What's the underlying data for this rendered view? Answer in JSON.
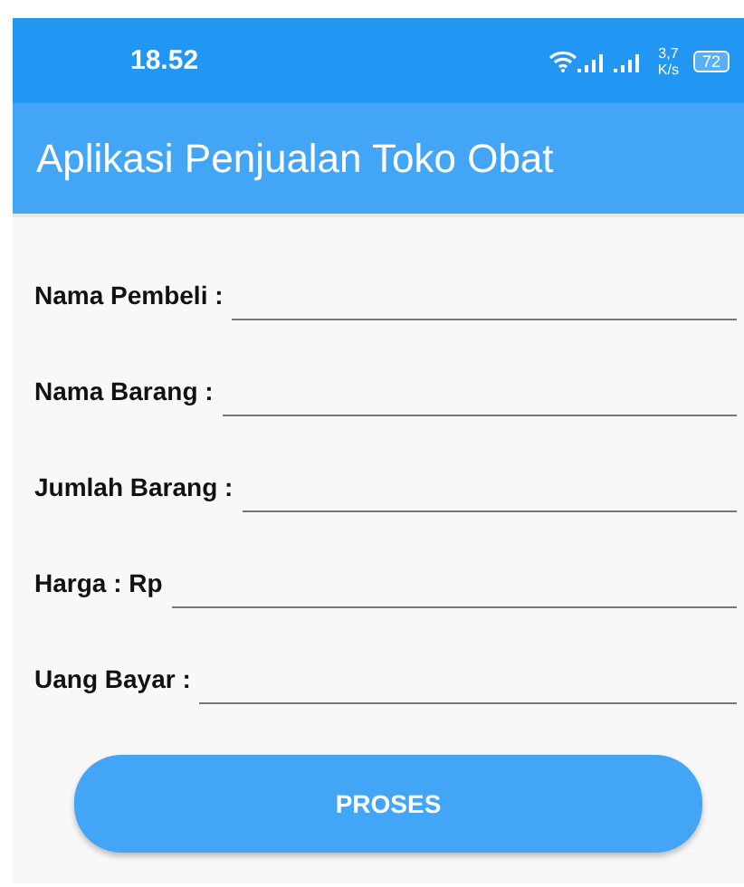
{
  "status_bar": {
    "time": "18.52",
    "speed_value": "3,7",
    "speed_unit": "K/s",
    "battery": "72"
  },
  "app_bar": {
    "title": "Aplikasi Penjualan Toko Obat"
  },
  "form": {
    "fields": [
      {
        "label": "Nama Pembeli :"
      },
      {
        "label": "Nama Barang :"
      },
      {
        "label": "Jumlah Barang :"
      },
      {
        "label": "Harga : Rp"
      },
      {
        "label": "Uang Bayar :"
      }
    ]
  },
  "button": {
    "label": "PROSES"
  }
}
